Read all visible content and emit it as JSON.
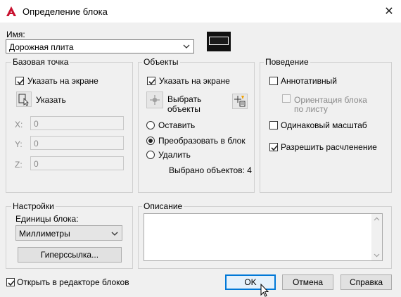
{
  "window": {
    "title": "Определение блока",
    "close_glyph": "✕"
  },
  "name": {
    "label": "Имя:",
    "value": "Дорожная плита"
  },
  "base_point": {
    "title": "Базовая точка",
    "specify_on_screen": "Указать на экране",
    "specify_on_screen_checked": true,
    "pick_button": "Указать",
    "x_label": "X:",
    "x_value": "0",
    "y_label": "Y:",
    "y_value": "0",
    "z_label": "Z:",
    "z_value": "0"
  },
  "objects": {
    "title": "Объекты",
    "specify_on_screen": "Указать на экране",
    "specify_on_screen_checked": true,
    "select_objects_line1": "Выбрать",
    "select_objects_line2": "объекты",
    "retain": "Оставить",
    "convert": "Преобразовать в блок",
    "delete": "Удалить",
    "selected_option": "convert",
    "selected_count": "Выбрано объектов: 4"
  },
  "behavior": {
    "title": "Поведение",
    "annotative": "Аннотативный",
    "annotative_checked": false,
    "orient_line1": "Ориентация блока",
    "orient_line2": "по листу",
    "scale_uniformly": "Одинаковый масштаб",
    "scale_uniformly_checked": false,
    "allow_exploding": "Разрешить расчленение",
    "allow_exploding_checked": true
  },
  "settings": {
    "title": "Настройки",
    "units_label": "Единицы блока:",
    "units_value": "Миллиметры",
    "hyperlink_button": "Гиперссылка..."
  },
  "description": {
    "title": "Описание",
    "value": ""
  },
  "footer": {
    "open_in_editor": "Открыть в редакторе блоков",
    "open_in_editor_checked": true,
    "ok": "OK",
    "cancel": "Отмена",
    "help": "Справка"
  },
  "colors": {
    "accent": "#0078d7",
    "app_red": "#c8102e"
  }
}
